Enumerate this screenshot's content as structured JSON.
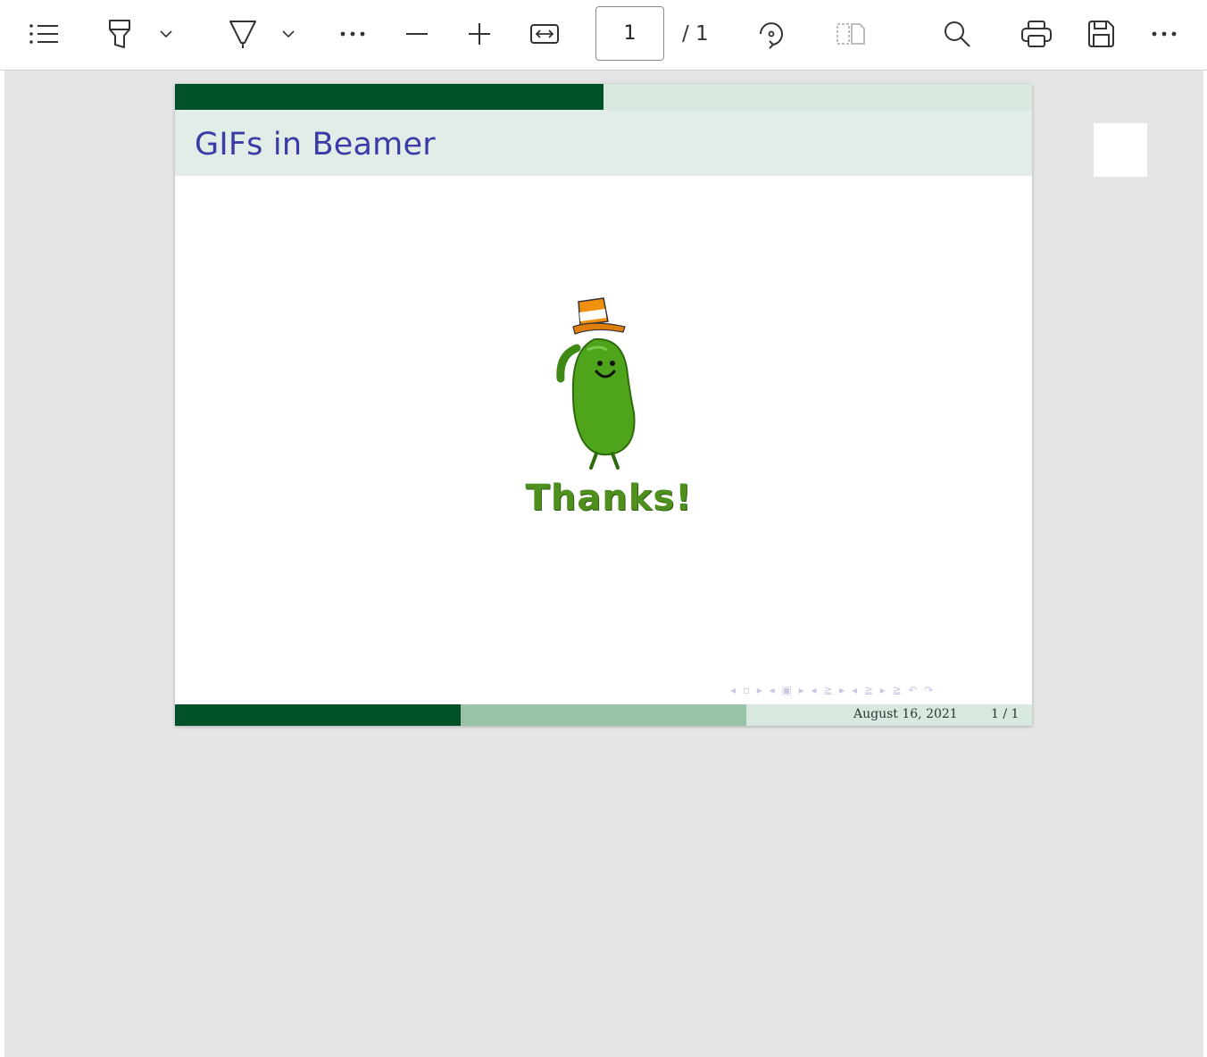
{
  "toolbar": {
    "contents_icon": "table-of-contents-icon",
    "highlight_icon": "highlighter-icon",
    "draw_icon": "pen-icon",
    "more_tools_icon": "more-horizontal-icon",
    "zoom_out_icon": "minus-icon",
    "zoom_in_icon": "plus-icon",
    "fit_icon": "fit-width-icon",
    "page_number": "1",
    "page_total": "/ 1",
    "rotate_icon": "rotate-icon",
    "two_page_icon": "page-view-icon",
    "search_icon": "search-icon",
    "print_icon": "printer-icon",
    "save_icon": "save-icon",
    "overflow_icon": "more-horizontal-icon"
  },
  "slide": {
    "title": "GIFs in Beamer",
    "image_caption": "Thanks!",
    "nav_symbols": "◂ ▫ ▸  ◂ ▣ ▸  ◂ ≧ ▸  ◂ ≧ ▸   ≧   ↶ ↷",
    "footer_date": "August 16, 2021",
    "footer_page": "1 / 1",
    "progress": 0.5
  },
  "colors": {
    "dark_green": "#005127",
    "mid_green": "#99c2a9",
    "light_green": "#d7e8df",
    "title_blue": "#3b3ba8"
  }
}
